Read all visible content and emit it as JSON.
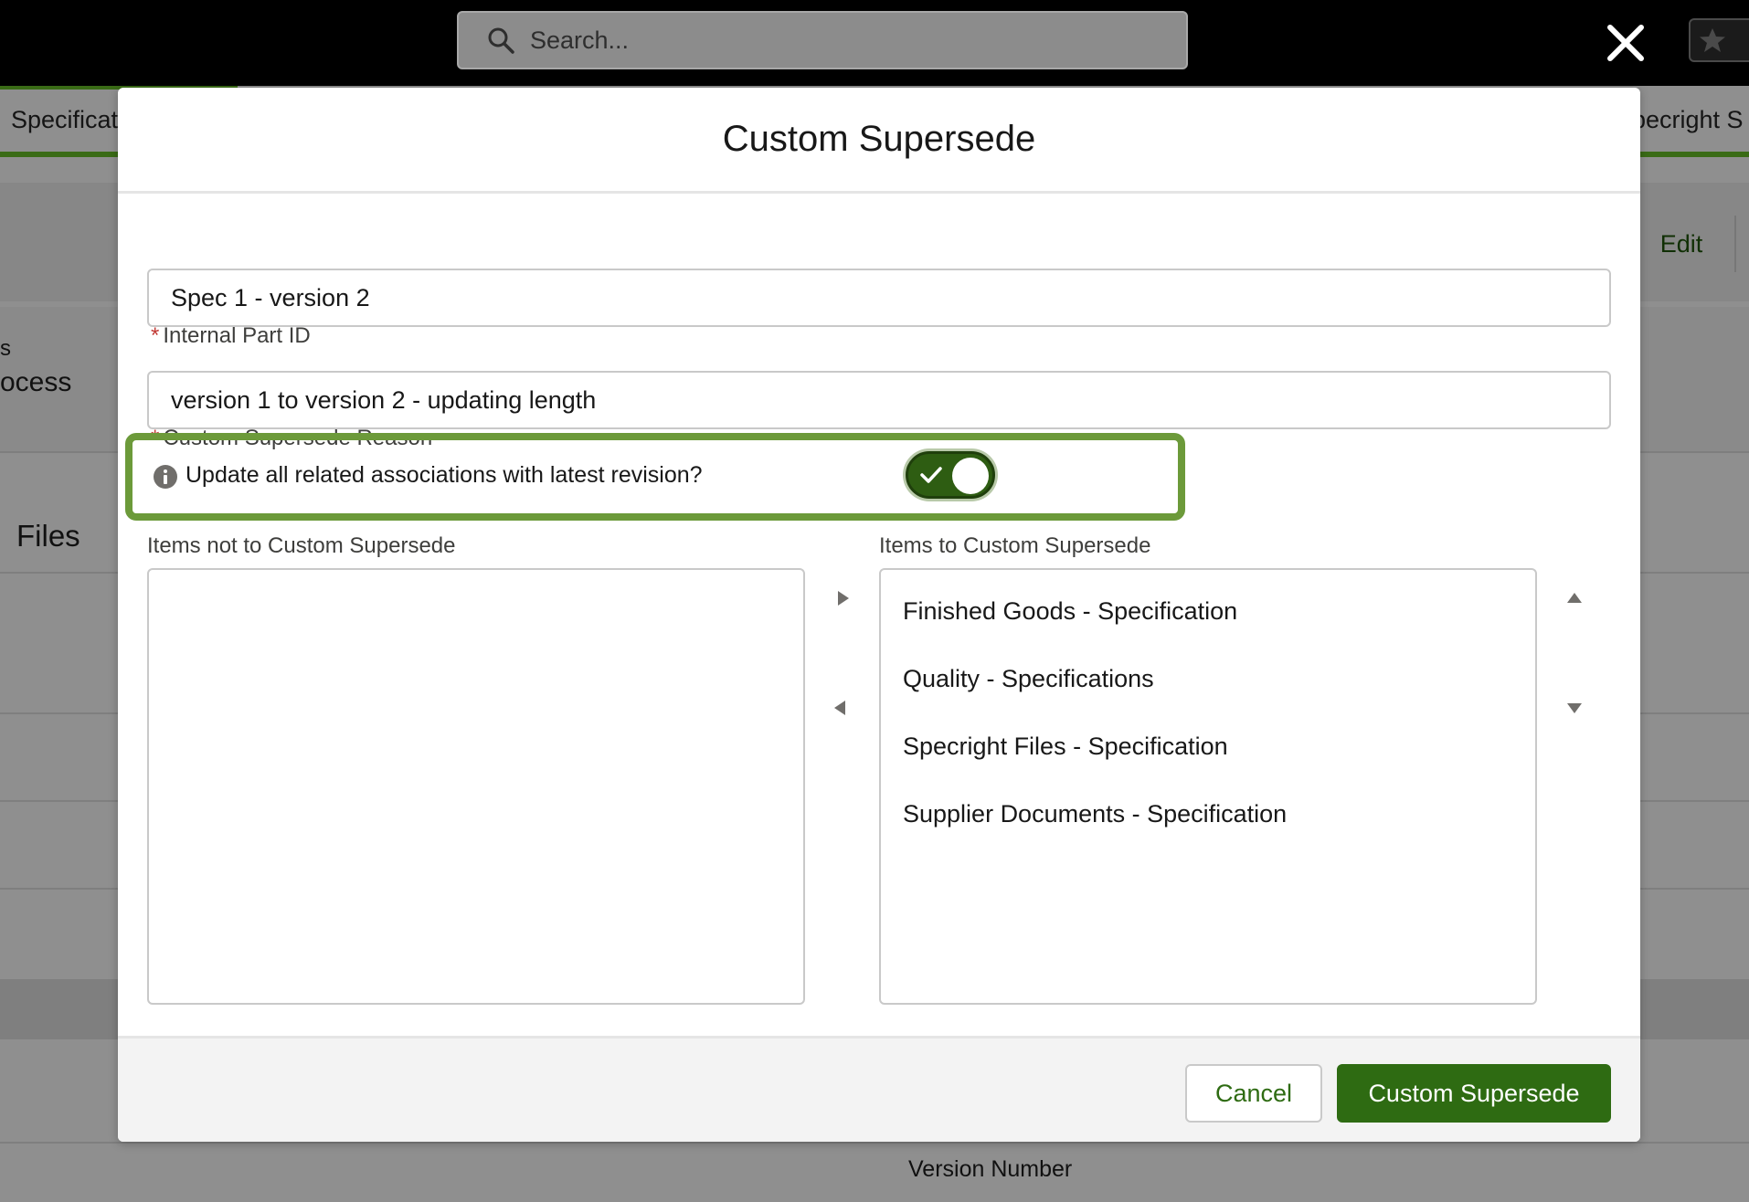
{
  "topbar": {
    "search_placeholder": "Search..."
  },
  "background": {
    "tab_left": "Specificat",
    "tab_right": "pecright S",
    "edit_label": "Edit",
    "side_label_s": "s",
    "side_label_process": "ocess",
    "files_heading": "Files",
    "version_number_label": "Version Number"
  },
  "modal": {
    "title": "Custom Supersede",
    "internal_part_id": {
      "label": "Internal Part ID",
      "required": "*",
      "value": "Spec 1 - version 2"
    },
    "reason": {
      "label": "Custom Supersede Reason",
      "required": "*",
      "value": "version 1 to version 2 - updating length"
    },
    "toggle": {
      "label": "Update all related associations with latest revision?",
      "checked": true
    },
    "available_list": {
      "label": "Items not to Custom Supersede",
      "items": []
    },
    "selected_list": {
      "label": "Items to Custom Supersede",
      "items": [
        "Finished Goods - Specification",
        "Quality - Specifications",
        "Specright Files - Specification",
        "Supplier Documents - Specification"
      ]
    },
    "footer": {
      "cancel_label": "Cancel",
      "submit_label": "Custom Supersede"
    }
  },
  "colors": {
    "brand_green": "#2e6b12",
    "highlight_green": "#6c9a3a",
    "required_red": "#c23934"
  }
}
